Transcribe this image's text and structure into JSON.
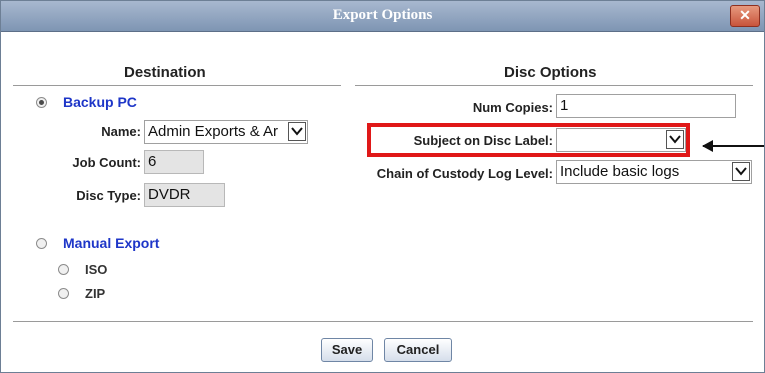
{
  "dialog": {
    "title": "Export Options",
    "close_symbol": "✕"
  },
  "destination": {
    "heading": "Destination",
    "backup_pc_label": "Backup PC",
    "name_label": "Name:",
    "name_value": "Admin Exports & Ar",
    "job_count_label": "Job Count:",
    "job_count_value": "6",
    "disc_type_label": "Disc Type:",
    "disc_type_value": "DVDR",
    "manual_export_label": "Manual Export",
    "iso_label": "ISO",
    "zip_label": "ZIP",
    "selected_option": "Backup PC"
  },
  "disc_options": {
    "heading": "Disc Options",
    "num_copies_label": "Num Copies:",
    "num_copies_value": "1",
    "subject_label": "Subject on Disc Label:",
    "subject_value": "",
    "custody_label": "Chain of Custody Log Level:",
    "custody_value": "Include basic logs"
  },
  "buttons": {
    "save": "Save",
    "cancel": "Cancel"
  },
  "colors": {
    "titlebar": "#8a9fbc",
    "highlight": "#e01818",
    "link_blue": "#1e36c8"
  }
}
